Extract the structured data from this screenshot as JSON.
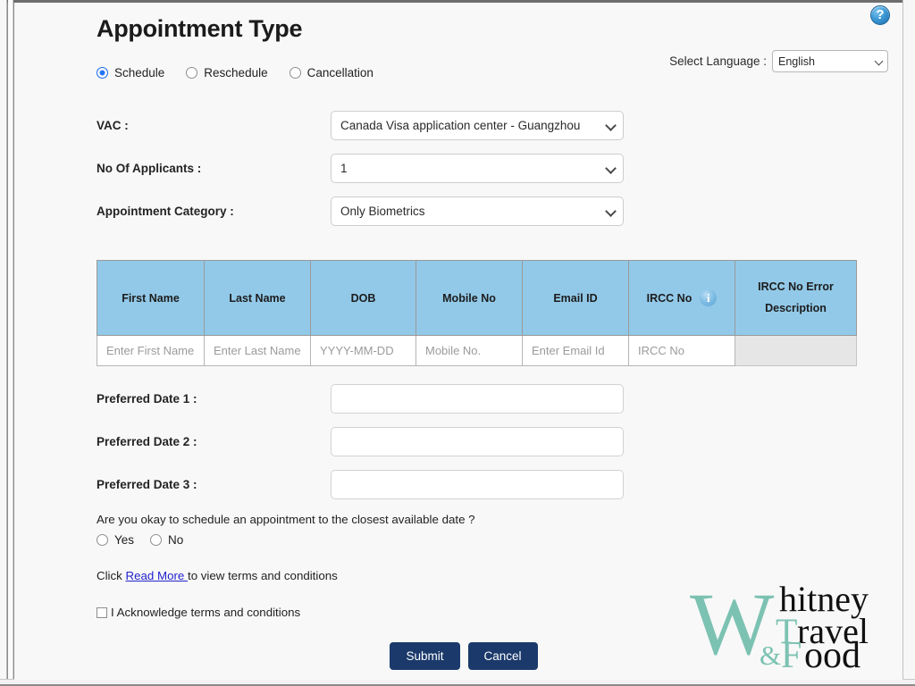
{
  "header": {
    "title": "Appointment Type",
    "help_icon": "help-question-icon",
    "language_label": "Select Language :",
    "language_value": "English"
  },
  "appointment_type": {
    "options": [
      {
        "label": "Schedule",
        "selected": true
      },
      {
        "label": "Reschedule",
        "selected": false
      },
      {
        "label": "Cancellation",
        "selected": false
      }
    ]
  },
  "fields": {
    "vac_label": "VAC :",
    "vac_value": "Canada Visa application center - Guangzhou",
    "applicants_label": "No Of Applicants :",
    "applicants_value": "1",
    "category_label": "Appointment Category :",
    "category_value": "Only Biometrics"
  },
  "applicants_table": {
    "headers": {
      "first_name": "First Name",
      "last_name": "Last Name",
      "dob": "DOB",
      "mobile_no": "Mobile No",
      "email_id": "Email ID",
      "ircc_no": "IRCC No",
      "ircc_error_line1": "IRCC No Error",
      "ircc_error_line2": "Description",
      "ircc_info_icon": "info-icon"
    },
    "row": {
      "first_name_placeholder": "Enter First Name",
      "first_name_value": "",
      "last_name_placeholder": "Enter Last Name",
      "last_name_value": "",
      "dob_placeholder": "YYYY-MM-DD",
      "dob_value": "",
      "mobile_placeholder": "Mobile No.",
      "mobile_value": "",
      "email_placeholder": "Enter Email Id",
      "email_value": "",
      "ircc_placeholder": "IRCC No",
      "ircc_value": "",
      "ircc_error_value": ""
    }
  },
  "preferred_dates": [
    {
      "label": "Preferred Date 1 :",
      "value": "",
      "placeholder": ""
    },
    {
      "label": "Preferred Date 2 :",
      "value": "",
      "placeholder": ""
    },
    {
      "label": "Preferred Date 3 :",
      "value": "",
      "placeholder": ""
    }
  ],
  "closest_date": {
    "question": "Are you okay to schedule an appointment to the closest available date ?",
    "yes_label": "Yes",
    "no_label": "No",
    "selected": ""
  },
  "terms": {
    "prefix": "Click ",
    "link_label": "Read More ",
    "suffix": "to view terms and conditions",
    "acknowledge_label": "I Acknowledge terms and conditions",
    "acknowledged": false
  },
  "actions": {
    "submit_label": "Submit",
    "cancel_label": "Cancel"
  },
  "watermark": {
    "w": "W",
    "hitney": "hitney",
    "t": "T",
    "ravel": "ravel",
    "amp": "&",
    "f": "F",
    "ood": "ood"
  },
  "colors": {
    "table_header_blue": "#92c9e8",
    "button_navy": "#1b3a6b",
    "radio_blue": "#2176f5",
    "link_blue": "#2222cc",
    "watermark_teal": "#7cc2b2"
  }
}
